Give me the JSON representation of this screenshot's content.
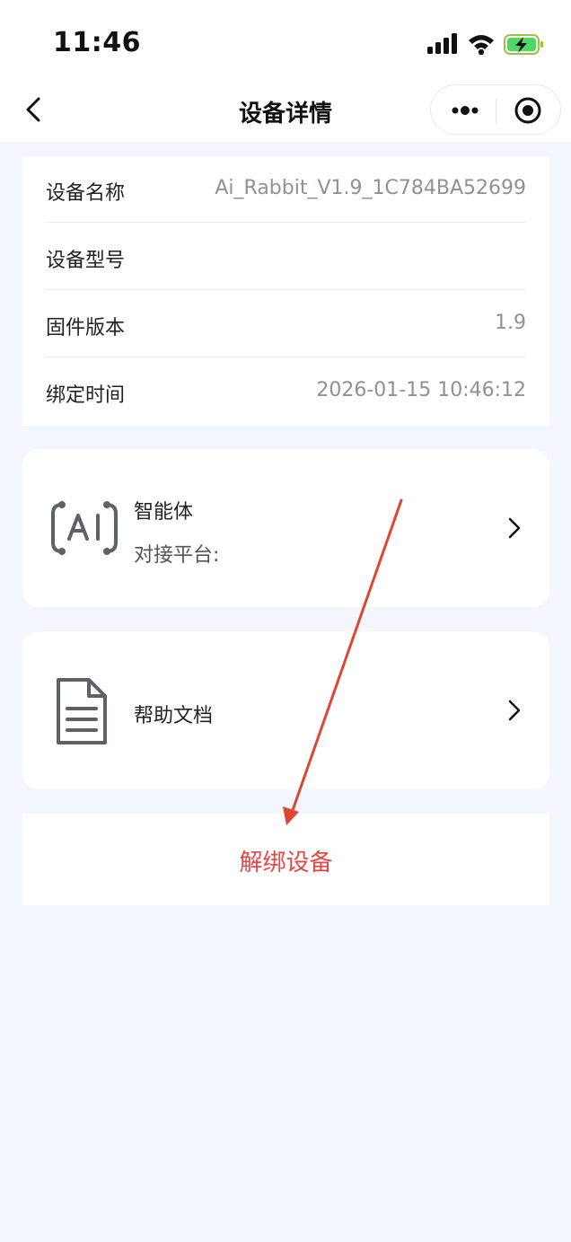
{
  "status_bar": {
    "time": "11:46"
  },
  "nav": {
    "title": "设备详情"
  },
  "device_info": [
    {
      "label": "设备名称",
      "value": "Ai_Rabbit_V1.9_1C784BA52699"
    },
    {
      "label": "设备型号",
      "value": ""
    },
    {
      "label": "固件版本",
      "value": "1.9"
    },
    {
      "label": "绑定时间",
      "value": "2026-01-15 10:46:12"
    }
  ],
  "agent_card": {
    "title": "智能体",
    "subtitle": "对接平台:"
  },
  "help_card": {
    "title": "帮助文档"
  },
  "unbind": {
    "label": "解绑设备"
  },
  "colors": {
    "accent_red": "#e84545",
    "annotation_arrow": "#e0452f",
    "background": "#f3f6fe"
  }
}
